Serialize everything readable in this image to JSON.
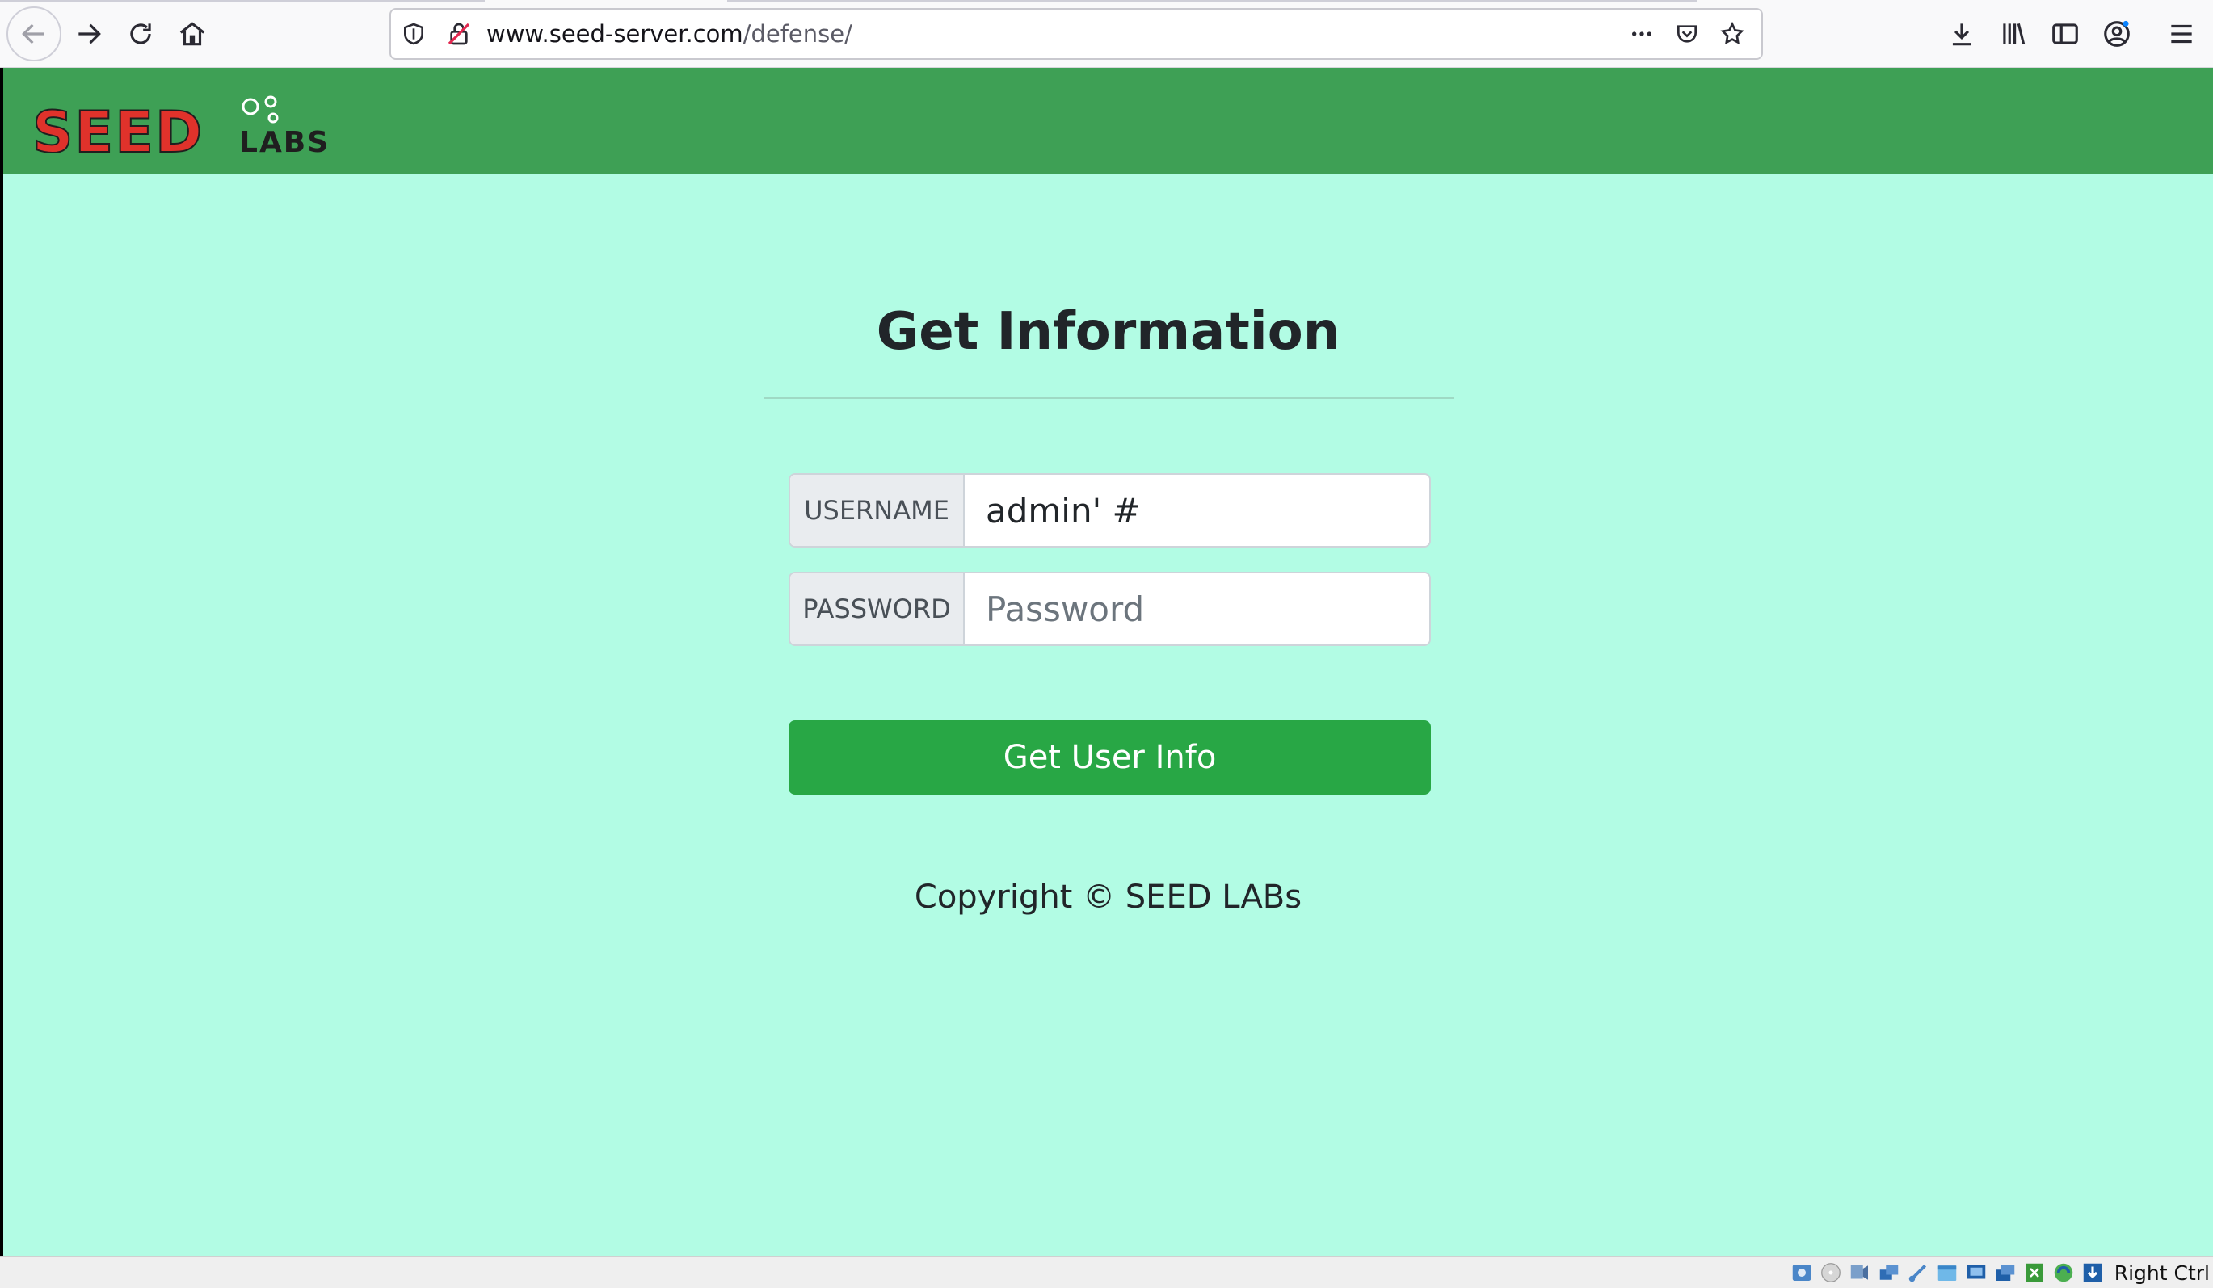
{
  "browser": {
    "url_host": "www.seed-server.com",
    "url_path": "/defense/",
    "icons": [
      "back-arrow-icon",
      "forward-arrow-icon",
      "reload-icon",
      "home-icon",
      "shield-icon",
      "insecure-lock-icon",
      "more-dots-icon",
      "pocket-icon",
      "bookmark-star-icon",
      "download-icon",
      "library-icon",
      "sidebar-icon",
      "account-icon",
      "hamburger-menu-icon"
    ]
  },
  "site": {
    "logo_text_main": "SEED",
    "logo_text_sub": "LABS",
    "logo_colors": {
      "seed": "#e0322b",
      "labs": "#1f1f1f"
    },
    "navbar_color": "#3ea055",
    "background_color": "#b2fce4"
  },
  "form": {
    "title": "Get Information",
    "username_label": "USERNAME",
    "username_value": "admin' #",
    "password_label": "PASSWORD",
    "password_placeholder": "Password",
    "submit_label": "Get User Info",
    "submit_color": "#28a745"
  },
  "footer": {
    "copyright": "Copyright © SEED LABs"
  },
  "statusbar": {
    "host_key": "Right Ctrl",
    "tray_icons": [
      "hard-disk-icon",
      "optical-drive-icon",
      "audio-icon",
      "network-icon",
      "usb-icon",
      "shared-folders-icon",
      "display-icon",
      "recording-icon",
      "clipboard-icon",
      "guest-additions-icon",
      "mouse-integration-icon"
    ]
  }
}
